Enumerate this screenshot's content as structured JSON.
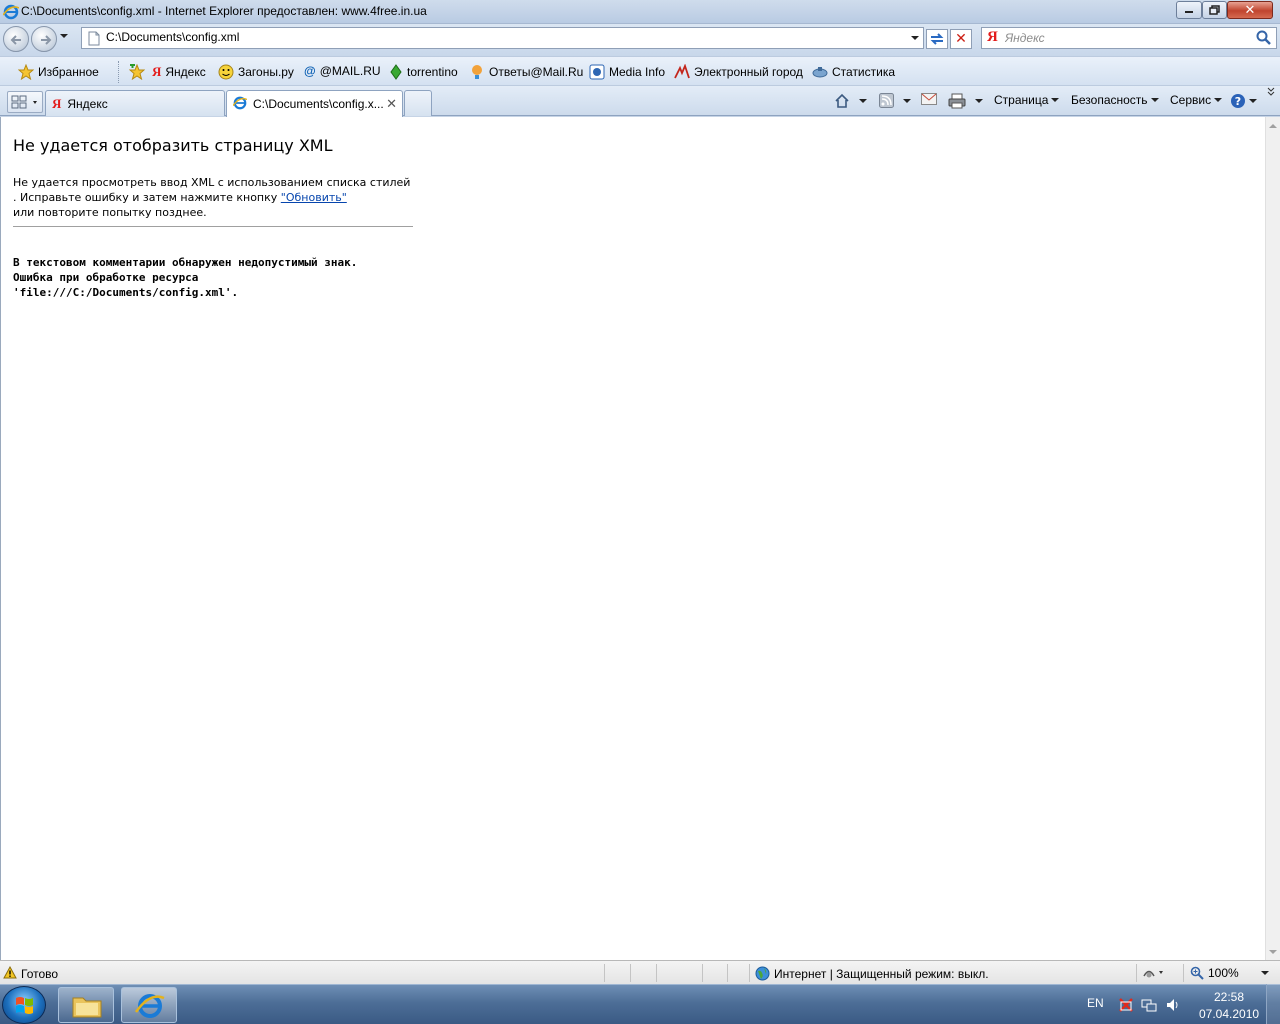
{
  "window": {
    "title": "C:\\Documents\\config.xml - Internet Explorer предоставлен: www.4free.in.ua"
  },
  "address": {
    "value": "C:\\Documents\\config.xml"
  },
  "search": {
    "placeholder": "Яндекс",
    "logo": "Я"
  },
  "favorites_bar": {
    "favorites_label": "Избранное",
    "items": [
      {
        "label": "Яндекс",
        "icon": "yandex-icon"
      },
      {
        "label": "Загоны.ру",
        "icon": "smiley-icon"
      },
      {
        "label": "@MAIL.RU",
        "icon": "at-icon"
      },
      {
        "label": "torrentino",
        "icon": "torrentino-icon"
      },
      {
        "label": "Ответы@Mail.Ru",
        "icon": "answers-icon"
      },
      {
        "label": "Media Info",
        "icon": "mediainfo-icon"
      },
      {
        "label": "Электронный город",
        "icon": "city-icon"
      },
      {
        "label": "Статистика",
        "icon": "stats-icon"
      }
    ]
  },
  "tabs": [
    {
      "label": "Яндекс",
      "active": false
    },
    {
      "label": "C:\\Documents\\config.x...",
      "active": true
    }
  ],
  "command_bar": {
    "page_label": "Страница",
    "safety_label": "Безопасность",
    "tools_label": "Сервис"
  },
  "content": {
    "heading": "Не удается отобразить страницу XML",
    "body_part1": "Не удается просмотреть ввод XML с использованием списка стилей . Исправьте ошибку и затем нажмите кнопку ",
    "refresh_link": "\"Обновить\"",
    "body_part2": " или повторите попытку позднее.",
    "detail_line1": "В текстовом комментарии обнаружен недопустимый знак.",
    "detail_line2": "Ошибка при обработке ресурса",
    "detail_line3": "'file:///C:/Documents/config.xml'."
  },
  "status_bar": {
    "status": "Готово",
    "zone": "Интернет | Защищенный режим: выкл.",
    "zoom": "100%"
  },
  "taskbar": {
    "language": "EN",
    "time": "22:58",
    "date": "07.04.2010"
  },
  "colors": {
    "link": "#0645ad",
    "close_button": "#c0442e",
    "taskbar": "#4d6e97"
  }
}
